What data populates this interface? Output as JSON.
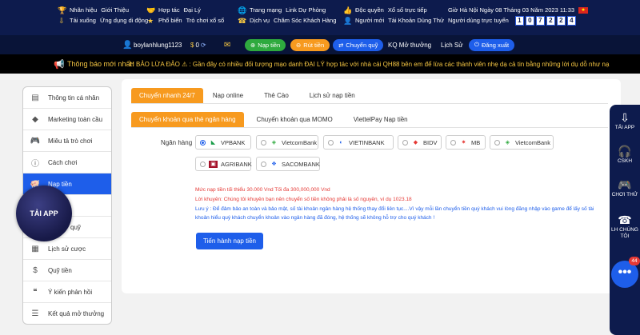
{
  "topbar": {
    "col1": [
      "Nhãn hiệu",
      "Giới Thiệu",
      "Tải xuống",
      "Ứng dụng di động"
    ],
    "col2": [
      "Hợp tác",
      "Đại Lý",
      "Phổ biến",
      "Trò chơi xổ số"
    ],
    "col3": [
      "Trang mạng",
      "Link Dự Phòng",
      "Dịch vụ",
      "Chăm Sóc Khách Hàng"
    ],
    "col4": [
      "Độc quyền",
      "Xổ số trực tiếp",
      "Người mới",
      "Tài Khoản Dùng Thử"
    ],
    "time_text": "Giờ Hà Nội   Ngày 08 Tháng 03 Năm 2023   11:33",
    "online_label": "Người dùng trực tuyến",
    "online_digits": [
      "1",
      "0",
      "7",
      "2",
      "2",
      "4"
    ],
    "flag": "★"
  },
  "userbar": {
    "username": "boylanhlung1123",
    "balance": "0",
    "deposit": "Nạp tiền",
    "withdraw": "Rút tiền",
    "transfer": "Chuyển quỹ",
    "results": "KQ Mở thưởng",
    "history": "Lịch Sử",
    "logout": "Đăng xuất"
  },
  "marquee": {
    "label": "Thông báo mới nhất:",
    "text": "H BẢO LỪA ĐẢO ⚠ :  Gần đây có nhiều đối tượng mạo danh ĐẠI LÝ hợp tác với nhà cái QH88 bên em để lừa các thành viên nhẹ dạ cả tin bằng những lời dụ dỗ như nạ"
  },
  "sidebar": {
    "items": [
      {
        "label": "Thông tin cá nhân"
      },
      {
        "label": "Marketing toàn cầu"
      },
      {
        "label": "Miêu tả trò chơi"
      },
      {
        "label": "Cách chơi"
      },
      {
        "label": "Nạp tiền"
      },
      {
        "label": ""
      },
      {
        "label": "quỹ"
      },
      {
        "label": "Lịch sử cược"
      },
      {
        "label": "Quỹ tiền"
      },
      {
        "label": "Ý kiến phản hồi"
      },
      {
        "label": "Kết quả mở thưởng"
      }
    ],
    "tai_app": "TẢI APP"
  },
  "main": {
    "tabs1": [
      "Chuyển nhanh 24/7",
      "Nạp online",
      "Thẻ Cào",
      "Lịch sử nạp tiền"
    ],
    "tabs2": [
      "Chuyển khoản qua thẻ ngân hàng",
      "Chuyển khoản qua MOMO",
      "ViettelPay Nạp tiền"
    ],
    "bank_label": "Ngân hàng",
    "banks": [
      "VPBANK",
      "VietcomBank",
      "VIETINBANK",
      "BIDV",
      "MB",
      "VietcomBank",
      "AGRIBANK",
      "SACOMBANK"
    ],
    "note_min": "Mức nạp tiền tối thiểu 30.000 Vnd Tối đa 300,000,000 Vnd",
    "note_advice": "Lời khuyên: Chúng tôi khuyên bạn nên chuyển số tiền không phải là số nguyên, ví dụ 1023.18",
    "note_warn1": "Lưu ý : Để đảm bảo an toàn và bảo mật, số tài khoản ngân hàng hệ thống thay đổi liên tục....Vì vậy mỗi lần chuyển tiền quý khách vui lòng đăng nhập vào game để lấy số tài",
    "note_warn2": "khoản hiểu quý khách chuyển khoản vào ngân hàng đã đóng, hệ thống sẽ không hỗ trợ cho quý khách !",
    "submit": "Tiến hành nạp tiền"
  },
  "rightbar": {
    "items": [
      "TẢI APP",
      "CSKH",
      "CHƠI THỬ",
      "LH CHÚNG TÔI"
    ],
    "chat_badge": "44"
  },
  "colors": {
    "navy": "#0d1b4d",
    "orange": "#f79a1f",
    "blue": "#1e5eea",
    "green": "#2eaa3e",
    "red": "#e53935"
  }
}
